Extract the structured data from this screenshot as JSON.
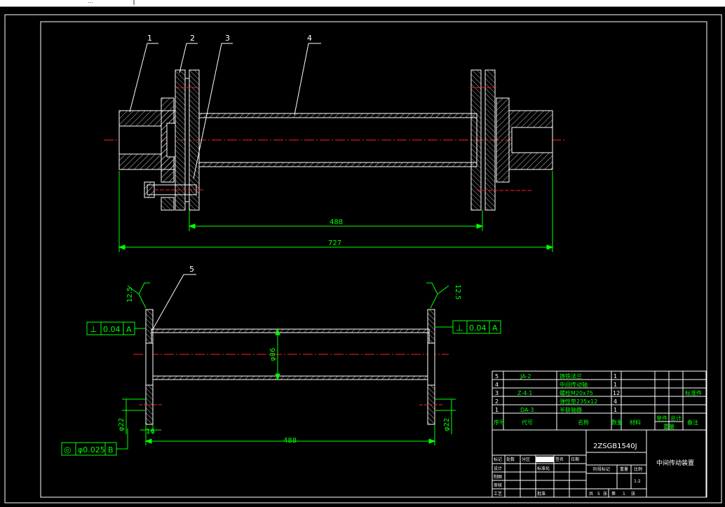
{
  "window": {
    "tab_label": "..."
  },
  "top_view": {
    "balloons": [
      "1",
      "2",
      "3",
      "4"
    ],
    "dims": {
      "inner": "488",
      "overall": "727"
    }
  },
  "bottom_view": {
    "balloon": "5",
    "roughness_left": "12.5",
    "roughness_right": "12.5",
    "tol_left": {
      "symbol": "⊥",
      "value": "0.04",
      "datum": "A"
    },
    "tol_right": {
      "symbol": "⊥",
      "value": "0.04",
      "datum": "A"
    },
    "tol_bottom": {
      "symbol": "◎",
      "value": "φ0.025",
      "datum": "B"
    },
    "dims": {
      "bore": "φ86",
      "length": "488",
      "flange": "16",
      "left_dia": "φ22",
      "right_dia": "φ22"
    }
  },
  "title_block": {
    "parts": [
      {
        "no": "5",
        "code": "JA-2",
        "name": "铸铁法兰",
        "qty": "1",
        "material": "",
        "remark": ""
      },
      {
        "no": "4",
        "code": "",
        "name": "中间传动轴",
        "qty": "1",
        "material": "",
        "remark": ""
      },
      {
        "no": "3",
        "code": "Z-4-1",
        "name": "螺栓M20x75",
        "qty": "12",
        "material": "",
        "remark": "标准件"
      },
      {
        "no": "2",
        "code": "",
        "name": "弹性垫235x12",
        "qty": "4",
        "material": "",
        "remark": ""
      },
      {
        "no": "1",
        "code": "DA-3",
        "name": "半联轴器",
        "qty": "1",
        "material": "",
        "remark": ""
      }
    ],
    "header": {
      "no": "序号",
      "code": "代号",
      "name": "名称",
      "qty": "数量",
      "material": "材料",
      "single": "单件",
      "total": "总计",
      "weight": "重量",
      "remark": "备注"
    },
    "drawing_no": "2ZSGB1540J",
    "drawing_name": "中间传动装置",
    "sig_rows": [
      "标记",
      "设计",
      "制图",
      "审核",
      "工艺"
    ],
    "sig_extra": [
      "处数",
      "分区",
      "标准化",
      "批准"
    ],
    "stage": {
      "label": "阶段标记",
      "weight": "重量",
      "scale": "比例",
      "scale_value": "1:2"
    },
    "sheet": {
      "total_label": "共",
      "total": "5",
      "unit": "张",
      "no_label": "第",
      "no": "1",
      "unit2": "张"
    },
    "date_labels": [
      "签名",
      "日期"
    ]
  },
  "colors": {
    "line": "#ffffff",
    "dim": "#00ff00",
    "center": "#ff2020",
    "hatch": "#ffffff",
    "table_green": "#00ff00"
  }
}
